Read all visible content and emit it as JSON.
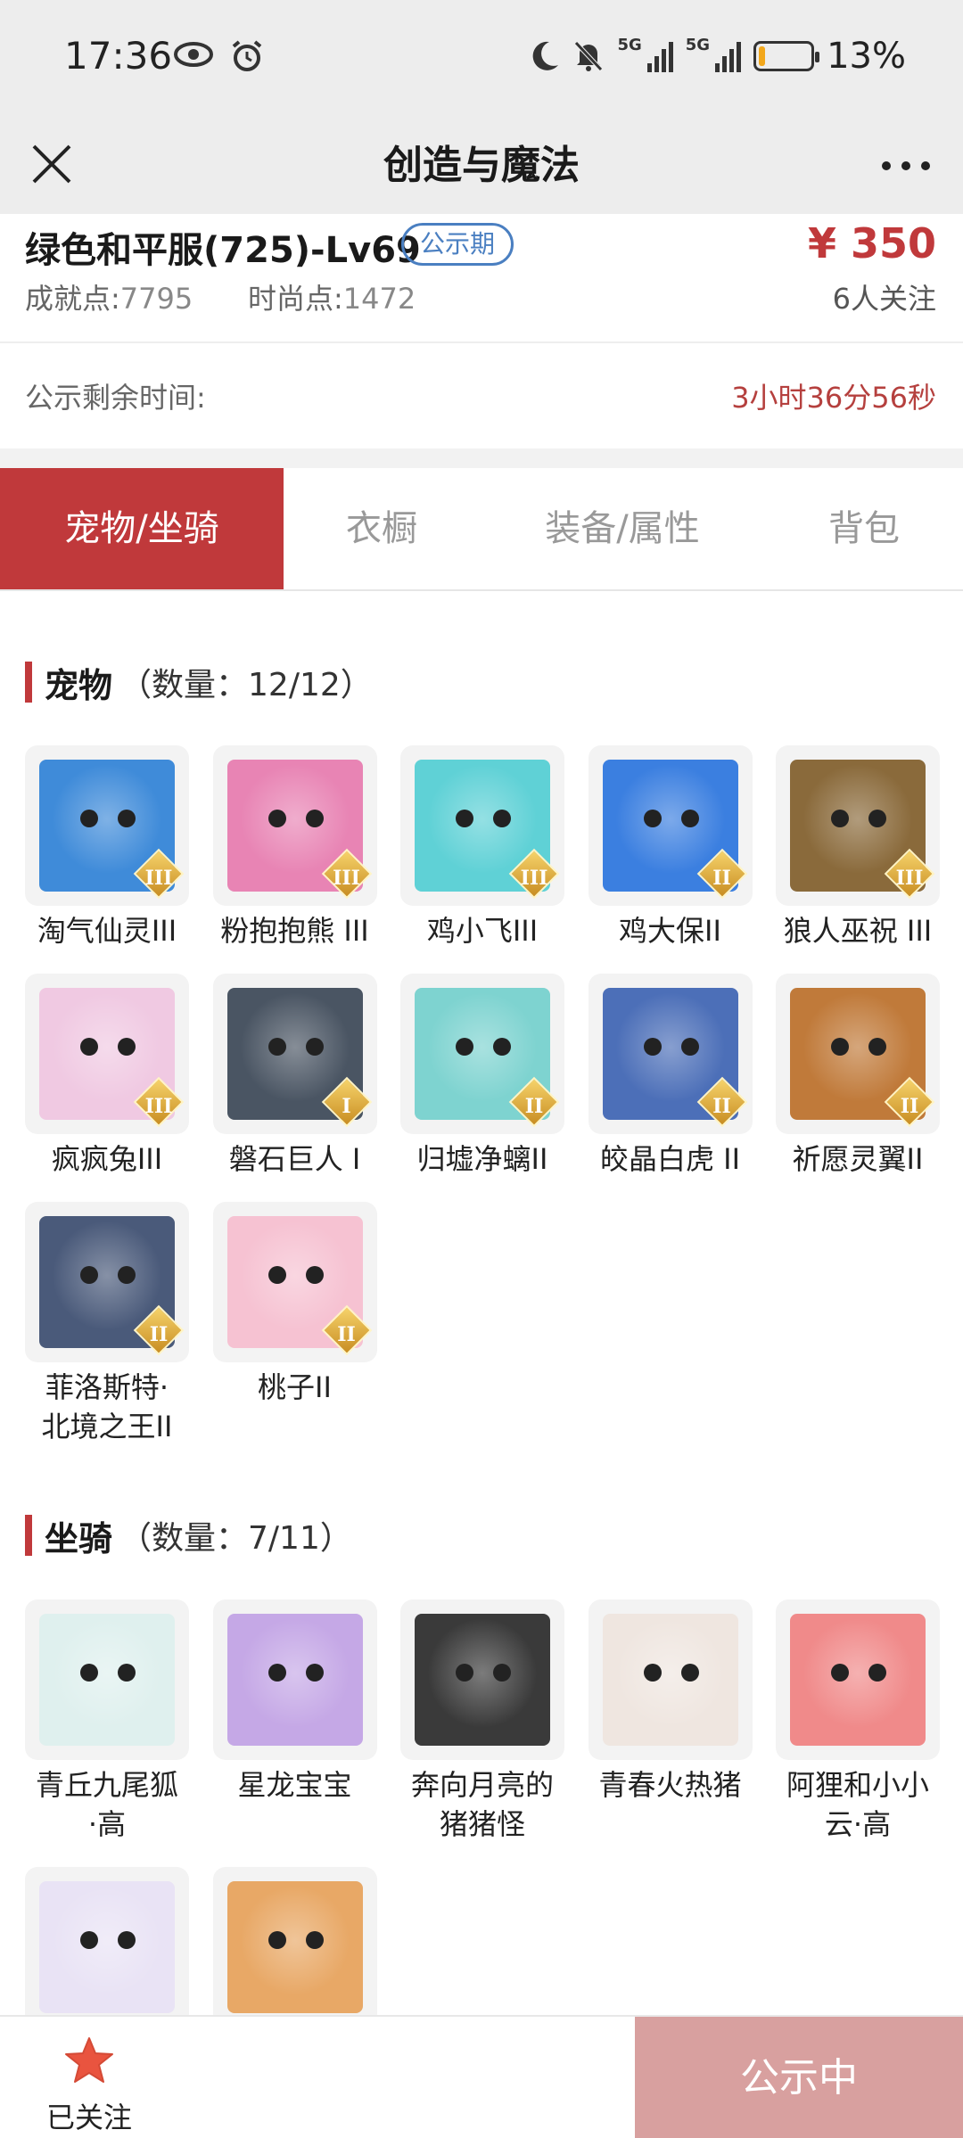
{
  "status_bar": {
    "time": "17:36",
    "battery": "13%",
    "battery_level": 0.13,
    "network_1": "5G",
    "network_2": "5G"
  },
  "nav": {
    "title": "创造与魔法"
  },
  "header": {
    "role_name": "绿色和平服(725)-Lv69",
    "badge": "公示期",
    "price": "¥ 350",
    "achievement_label": "成就点:",
    "achievement_value": "7795",
    "fashion_label": "时尚点:",
    "fashion_value": "1472",
    "followers": "6人关注"
  },
  "remain": {
    "label": "公示剩余时间:",
    "value": "3小时36分56秒"
  },
  "tabs": [
    "宠物/坐骑",
    "衣橱",
    "装备/属性",
    "背包"
  ],
  "pets": {
    "title": "宠物",
    "count": "（数量：12/12）",
    "items": [
      {
        "name": "淘气仙灵III",
        "rank": "III",
        "color": "#3f8bd9"
      },
      {
        "name": "粉抱抱熊 III",
        "rank": "III",
        "color": "#e884b4"
      },
      {
        "name": "鸡小飞III",
        "rank": "III",
        "color": "#5fd1d6"
      },
      {
        "name": "鸡大保II",
        "rank": "II",
        "color": "#3b7fe0"
      },
      {
        "name": "狼人巫祝 III",
        "rank": "III",
        "color": "#8a6a3b"
      },
      {
        "name": "疯疯兔III",
        "rank": "III",
        "color": "#f0c9e2"
      },
      {
        "name": "磐石巨人 I",
        "rank": "I",
        "color": "#4a5563"
      },
      {
        "name": "归墟净螭II",
        "rank": "II",
        "color": "#7ed3d0"
      },
      {
        "name": "皎晶白虎 II",
        "rank": "II",
        "color": "#4c6fb8"
      },
      {
        "name": "祈愿灵翼II",
        "rank": "II",
        "color": "#c07a3a"
      },
      {
        "name": "菲洛斯特·北境之王II",
        "name_line1": "菲洛斯特·",
        "name_line2": "北境之王II",
        "rank": "II",
        "color": "#4a5a7a"
      },
      {
        "name": "桃子II",
        "rank": "II",
        "color": "#f6c2d2"
      }
    ]
  },
  "mounts": {
    "title": "坐骑",
    "count": "（数量：7/11）",
    "items": [
      {
        "name_line1": "青丘九尾狐",
        "name_line2": "·高",
        "color": "#dff0ee"
      },
      {
        "name_line1": "星龙宝宝",
        "name_line2": "",
        "color": "#c5a8e6"
      },
      {
        "name_line1": "奔向月亮的",
        "name_line2": "猪猪怪",
        "color": "#3a3a3a"
      },
      {
        "name_line1": "青春火热猪",
        "name_line2": "",
        "color": "#efe6e0"
      },
      {
        "name_line1": "阿狸和小小",
        "name_line2": "云·高",
        "color": "#f08a8a"
      },
      {
        "name_line1": "",
        "name_line2": "",
        "color": "#e9e3f5"
      },
      {
        "name_line1": "",
        "name_line2": "",
        "color": "#e8a866"
      }
    ]
  },
  "bottom": {
    "follow_label": "已关注",
    "status_button": "公示中"
  }
}
